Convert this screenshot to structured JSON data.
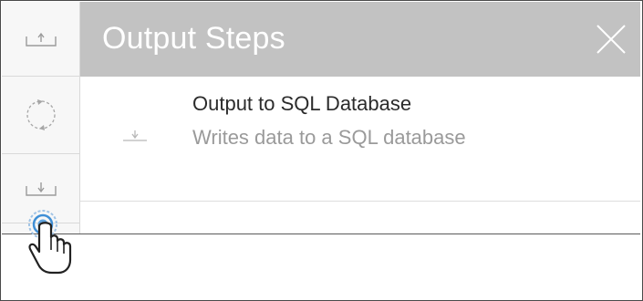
{
  "panel": {
    "title": "Output Steps"
  },
  "left_rail": {
    "items": [
      {
        "icon": "upload-icon"
      },
      {
        "icon": "sync-icon"
      },
      {
        "icon": "download-icon"
      }
    ]
  },
  "steps": [
    {
      "title": "Output to SQL Database",
      "description": "Writes data to a SQL database",
      "icon": "download-icon"
    }
  ],
  "colors": {
    "header_bg": "#c2c2c2",
    "title_text": "#2b2b2b",
    "desc_text": "#9a9a9a",
    "click_ring": "#3f8fd6"
  }
}
